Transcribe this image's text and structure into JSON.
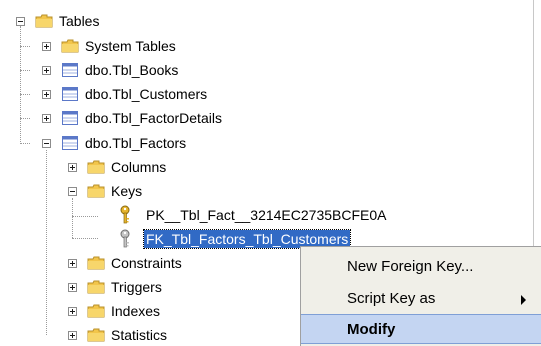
{
  "tree": {
    "root": {
      "label": "Tables",
      "expander": "-"
    },
    "tables": [
      {
        "label": "System Tables",
        "expander": "+",
        "icon": "folder-icon"
      },
      {
        "label": "dbo.Tbl_Books",
        "expander": "+",
        "icon": "table-icon"
      },
      {
        "label": "dbo.Tbl_Customers",
        "expander": "+",
        "icon": "table-icon"
      },
      {
        "label": "dbo.Tbl_FactorDetails",
        "expander": "+",
        "icon": "table-icon"
      },
      {
        "label": "dbo.Tbl_Factors",
        "expander": "-",
        "icon": "table-icon"
      }
    ],
    "factor_children": [
      {
        "label": "Columns",
        "expander": "+"
      },
      {
        "label": "Keys",
        "expander": "-"
      },
      {
        "label": "Constraints",
        "expander": "+"
      },
      {
        "label": "Triggers",
        "expander": "+"
      },
      {
        "label": "Indexes",
        "expander": "+"
      },
      {
        "label": "Statistics",
        "expander": "+"
      }
    ],
    "keys": [
      {
        "label": "PK__Tbl_Fact__3214EC2735BCFE0A",
        "icon": "gold-key-icon"
      },
      {
        "label": "FK_Tbl_Factors_Tbl_Customers",
        "icon": "gray-key-icon",
        "selected": true
      }
    ]
  },
  "context_menu": {
    "items": [
      {
        "label": "New Foreign Key...",
        "has_submenu": false
      },
      {
        "label": "Script Key as",
        "has_submenu": true
      },
      {
        "label": "Modify",
        "has_submenu": false,
        "highlighted": true
      }
    ]
  },
  "colors": {
    "selection": "#316ac5",
    "menu_background": "#f0efe8",
    "menu_highlight": "#c4d5f2",
    "folder": "#f2c54a",
    "table": "#5b78c8"
  }
}
